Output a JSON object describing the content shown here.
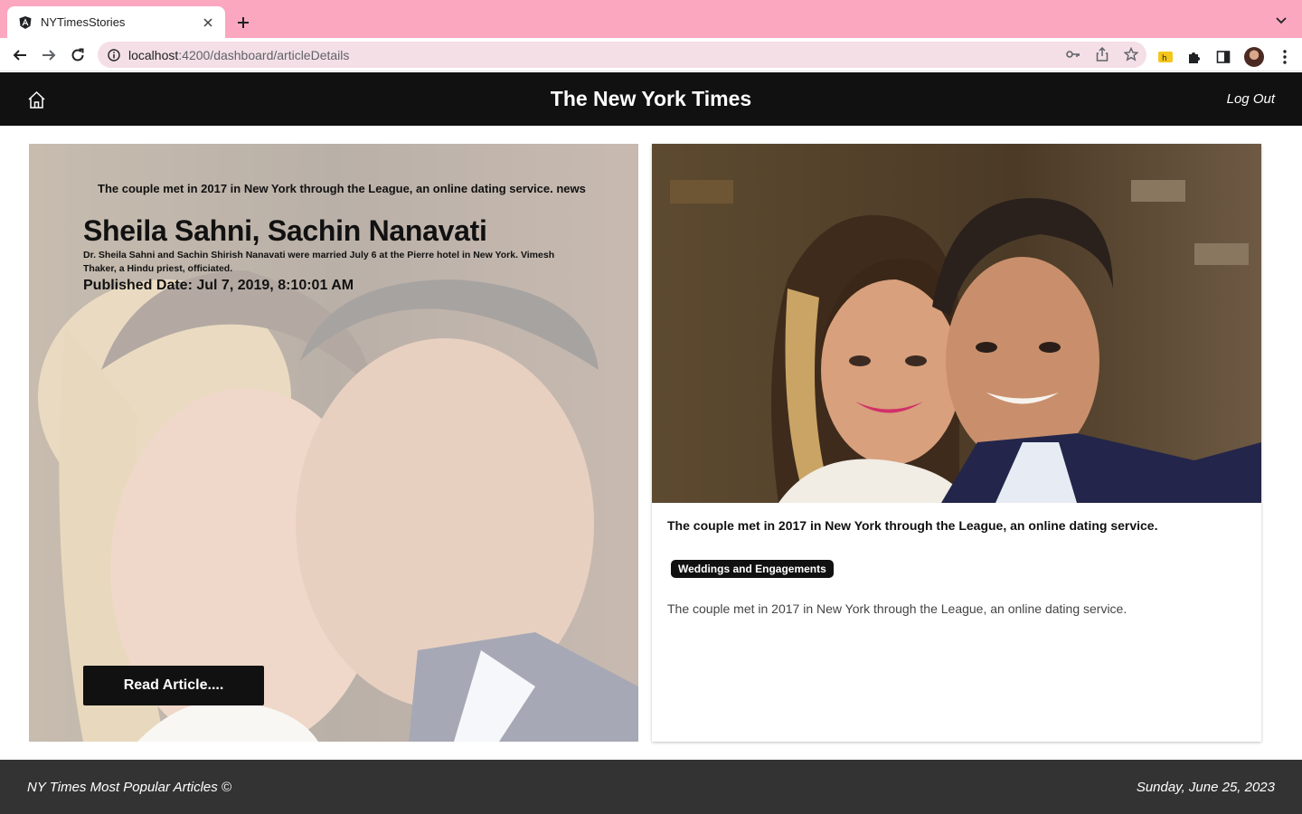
{
  "browser": {
    "tab_title": "NYTimesStories",
    "url_host": "localhost",
    "url_path": ":4200/dashboard/articleDetails",
    "accent_color": "#fba7bf"
  },
  "header": {
    "title": "The New York Times",
    "logout_label": "Log Out"
  },
  "hero": {
    "kicker": "The couple met in 2017 in New York through the League, an online dating service. news",
    "headline": "Sheila Sahni, Sachin Nanavati",
    "abstract": "Dr. Sheila Sahni and Sachin Shirish Nanavati were married July 6 at the Pierre hotel in New York. Vimesh Thaker, a Hindu priest, officiated.",
    "published": "Published Date: Jul 7, 2019, 8:10:01 AM",
    "read_button": "Read Article...."
  },
  "card": {
    "kicker": "The couple met in 2017 in New York through the League, an online dating service.",
    "section_badge": "Weddings and Engagements",
    "abstract": "The couple met in 2017 in New York through the League, an online dating service."
  },
  "footer": {
    "left": "NY Times Most Popular Articles ©",
    "right": "Sunday, June 25, 2023"
  }
}
